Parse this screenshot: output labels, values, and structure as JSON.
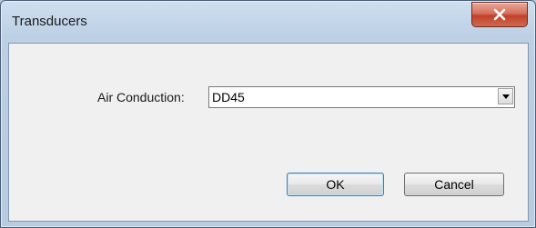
{
  "window": {
    "title": "Transducers",
    "close_icon": "close-icon"
  },
  "form": {
    "air_conduction_label": "Air Conduction:",
    "air_conduction_value": "DD45",
    "dropdown_icon": "chevron-down-icon"
  },
  "buttons": {
    "ok_label": "OK",
    "cancel_label": "Cancel"
  },
  "colors": {
    "frame": "#b9c9dc",
    "client": "#f0f0f0",
    "close_button": "#c7432f"
  }
}
